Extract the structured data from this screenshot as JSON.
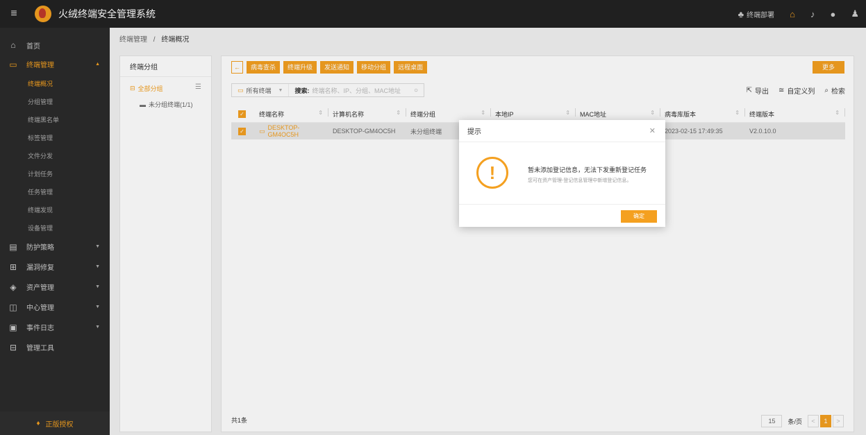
{
  "app": {
    "title": "火绒终端安全管理系统"
  },
  "topbar": {
    "deploy_label": "终端部署"
  },
  "sidebar": {
    "home": "首页",
    "terminal_mgmt": "终端管理",
    "subitems": [
      "终端概况",
      "分组管理",
      "终端黑名单",
      "标签管理",
      "文件分发",
      "计划任务",
      "任务管理",
      "终端发现",
      "设备管理"
    ],
    "groups": [
      "防护策略",
      "漏洞修复",
      "资产管理",
      "中心管理",
      "事件日志",
      "管理工具"
    ],
    "license": "正版授权"
  },
  "breadcrumb": {
    "parent": "终端管理",
    "separator": "/",
    "current": "终端概况"
  },
  "left_panel": {
    "title": "终端分组",
    "all_groups": "全部分组",
    "ungrouped": "未分组终端(1/1)"
  },
  "toolbar": {
    "buttons": [
      "病毒查杀",
      "终端升级",
      "发送通知",
      "移动分组",
      "远程桌面"
    ],
    "more": "更多"
  },
  "filter": {
    "terminal_type": "所有终端",
    "search_label": "搜索:",
    "search_placeholder": "终端名称、IP、分组、MAC地址"
  },
  "actions": {
    "export": "导出",
    "custom_columns": "自定义列",
    "search": "检索"
  },
  "table": {
    "headers": [
      "终端名称",
      "计算机名称",
      "终端分组",
      "本地IP",
      "MAC地址",
      "病毒库版本",
      "终端版本"
    ],
    "rows": [
      {
        "name": "DESKTOP-GM4OC5H",
        "computer": "DESKTOP-GM4OC5H",
        "group": "未分组终端",
        "virus_db": "2023-02-15 17:49:35",
        "version": "V2.0.10.0"
      }
    ]
  },
  "footer": {
    "total": "共1条",
    "page_size": "15",
    "per_page": "条/页",
    "current_page": "1",
    "prev": "<",
    "next": ">"
  },
  "modal": {
    "title": "提示",
    "message": "暂未添加登记信息，无法下发重新登记任务",
    "sub": "您可在资产管理-登记信息管理中新增登记信息。",
    "ok": "确定"
  },
  "colors": {
    "accent": "#f4a020",
    "topbar": "#232323",
    "sidebar": "#2b2b2b"
  }
}
